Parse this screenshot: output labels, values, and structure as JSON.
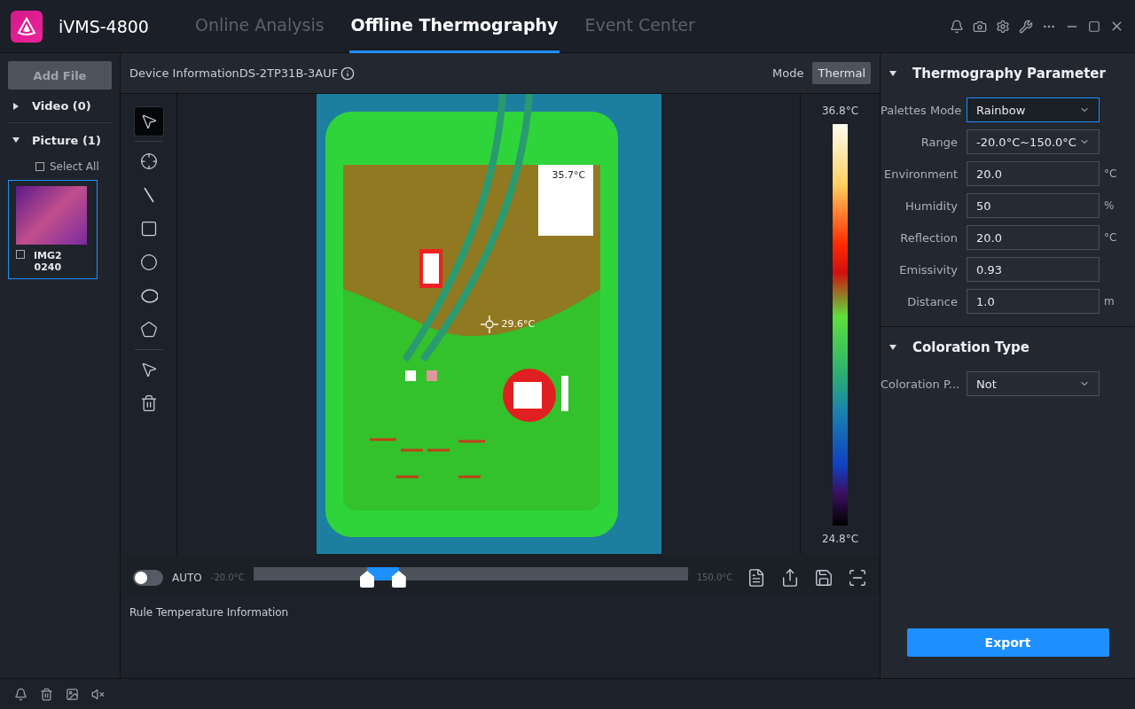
{
  "app": {
    "title": "iVMS-4800"
  },
  "nav_tabs": [
    {
      "label": "Online Analysis",
      "selected": false
    },
    {
      "label": "Offline Thermography",
      "selected": true
    },
    {
      "label": "Event Center",
      "selected": false
    }
  ],
  "sidebar": {
    "add_button": "Add File",
    "groups": [
      {
        "label": "Video (0)",
        "expanded": false
      },
      {
        "label": "Picture (1)",
        "expanded": true
      }
    ],
    "select_all": {
      "label": "Select All",
      "checked": false
    },
    "files": [
      {
        "name": "IMG2\n0240",
        "checked": false,
        "selected": true
      }
    ]
  },
  "viewer": {
    "device_label": "Device InformationDS-2TP31B-3AUF",
    "mode_label": "Mode",
    "mode_value": "Thermal",
    "tools": [
      {
        "kind": "select",
        "selected": true
      },
      {
        "kind": "point",
        "selected": false
      },
      {
        "kind": "line",
        "selected": false
      },
      {
        "kind": "rect",
        "selected": false
      },
      {
        "kind": "circle",
        "selected": false
      },
      {
        "kind": "ellipse",
        "selected": false
      },
      {
        "kind": "polygon",
        "selected": false
      },
      {
        "kind": "select-clear",
        "selected": false
      },
      {
        "kind": "delete",
        "selected": false
      }
    ],
    "max_marker": "35.7°C",
    "center_marker": "29.6°C",
    "scale_max": "36.8°C",
    "scale_min": "24.8°C",
    "auto": {
      "label": "AUTO",
      "on": false
    },
    "range_min": "-20.0°C",
    "range_max": "150.0°C",
    "handles": [
      {
        "level": 0.262
      },
      {
        "level": 0.335
      }
    ],
    "rule_info": "Rule Temperature Information"
  },
  "params": {
    "title": "Thermography Parameter",
    "expanded": true,
    "fields": [
      {
        "label": "Palettes Mode",
        "value": "Rainbow",
        "kind": "select",
        "focused": true
      },
      {
        "label": "Range",
        "value": "-20.0°C~150.0°C",
        "kind": "select",
        "focused": false
      },
      {
        "label": "Environment",
        "value": "20.0",
        "unit": "°C",
        "kind": "input",
        "focused": false
      },
      {
        "label": "Humidity",
        "value": "50",
        "unit": "%",
        "kind": "input",
        "focused": false
      },
      {
        "label": "Reflection",
        "value": "20.0",
        "unit": "°C",
        "kind": "input",
        "focused": false
      },
      {
        "label": "Emissivity",
        "value": "0.93",
        "kind": "input",
        "focused": false
      },
      {
        "label": "Distance",
        "value": "1.0",
        "unit": "m",
        "kind": "input",
        "focused": false
      }
    ]
  },
  "coloration": {
    "title": "Coloration Type",
    "expanded": true,
    "fields": [
      {
        "label": "Coloration P...",
        "value": "Not",
        "kind": "select",
        "focused": false
      }
    ]
  },
  "export_button": "Export"
}
